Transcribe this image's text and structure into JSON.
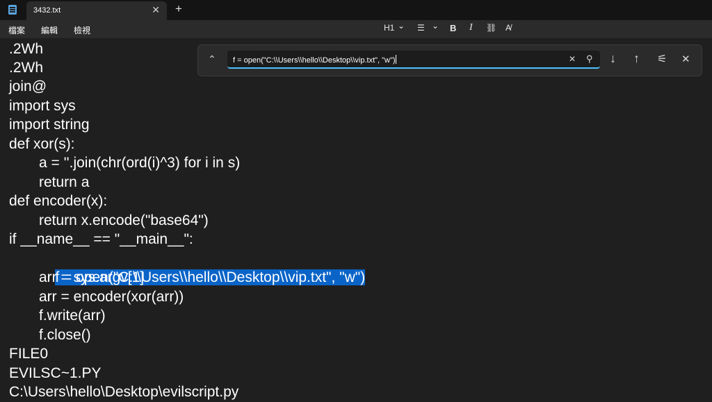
{
  "window": {
    "tab_title": "3432.txt",
    "tab_close": "✕",
    "new_tab": "+"
  },
  "menu": {
    "file": "檔案",
    "edit": "編輯",
    "view": "檢視"
  },
  "toolbar": {
    "heading": "H1",
    "heading_arrow": "⌄",
    "list": "☰",
    "list_arrow": "⌄",
    "bold": "B",
    "italic": "I",
    "link": "⛓",
    "clear_format": "A̸"
  },
  "find": {
    "query": "f = open(\"C:\\\\Users\\\\hello\\\\Desktop\\\\vip.txt\", \"w\")",
    "collapse": "⌃",
    "clear": "✕",
    "search": "⚲",
    "next": "↓",
    "prev": "↑",
    "options": "⚟",
    "close": "✕"
  },
  "document": {
    "lines": [
      ".2Wh",
      ".2Wh",
      "join@",
      "import sys",
      "import string",
      "def xor(s):",
      "a = ''.join(chr(ord(i)^3) for i in s)",
      "return a",
      "def encoder(x):",
      "return x.encode(\"base64\")",
      "if __name__ == \"__main__\":",
      "f = open(\"C:\\\\Users\\\\hello\\\\Desktop\\\\vip.txt\", \"w\")",
      "arr = sys.argv[1]",
      "arr = encoder(xor(arr))",
      "f.write(arr)",
      "f.close()",
      "FILE0",
      "EVILSC~1.PY",
      "C:\\Users\\hello\\Desktop\\evilscript.py"
    ]
  },
  "colors": {
    "accent": "#4cc2ff",
    "selection": "#0a64c8",
    "spellcheck": "#d13438",
    "background": "#1f1f1f"
  }
}
